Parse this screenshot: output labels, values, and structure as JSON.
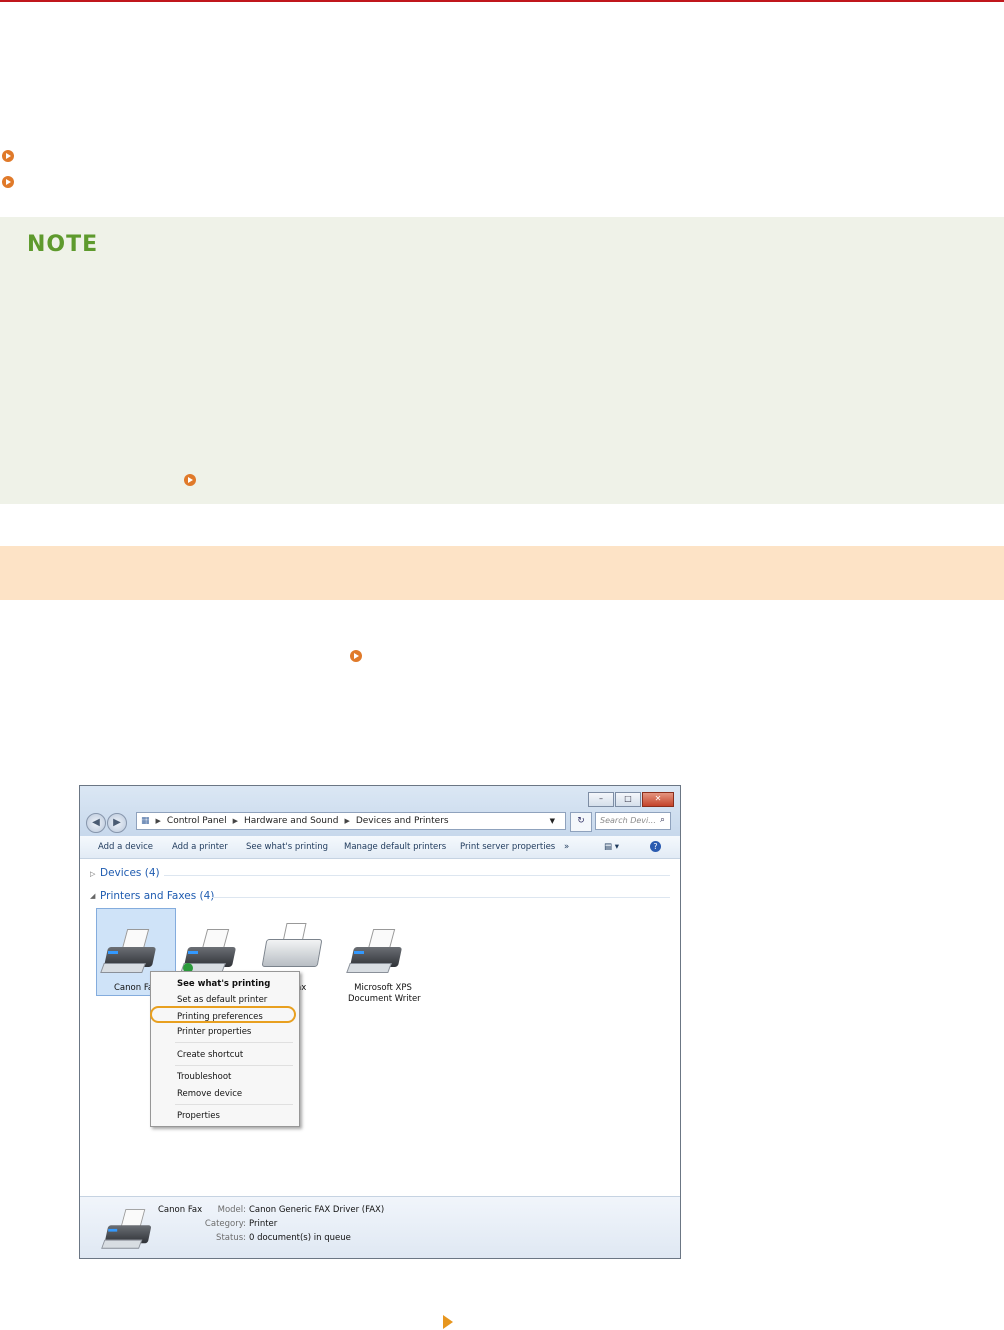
{
  "window": {
    "breadcrumb": [
      "Control Panel",
      "Hardware and Sound",
      "Devices and Printers"
    ],
    "search_placeholder": "Search Devi...",
    "toolbar": [
      "Add a device",
      "Add a printer",
      "See what's printing",
      "Manage default printers",
      "Print server properties",
      "»"
    ],
    "groups": {
      "devices": "Devices (4)",
      "printers": "Printers and Faxes (4)"
    },
    "printers": {
      "canon_fax_partial": "Canon Fa",
      "fax_partial": "ax",
      "xps_line1": "Microsoft XPS",
      "xps_line2": "Document Writer"
    },
    "context_menu": {
      "see_printing": "See what's printing",
      "set_default": "Set as default printer",
      "printing_prefs": "Printing preferences",
      "printer_props": "Printer properties",
      "create_shortcut": "Create shortcut",
      "troubleshoot": "Troubleshoot",
      "remove_device": "Remove device",
      "properties": "Properties"
    },
    "details": {
      "name": "Canon Fax",
      "model_label": "Model:",
      "model_value": "Canon Generic FAX Driver (FAX)",
      "category_label": "Category:",
      "category_value": "Printer",
      "status_label": "Status:",
      "status_value": "0 document(s) in queue"
    }
  },
  "page": {
    "note_title": "NOTE",
    "accent_red": "#c0171c",
    "accent_orange": "#e07a2a",
    "note_bg": "#eff2e8",
    "section_bg": "#fde3c6"
  }
}
